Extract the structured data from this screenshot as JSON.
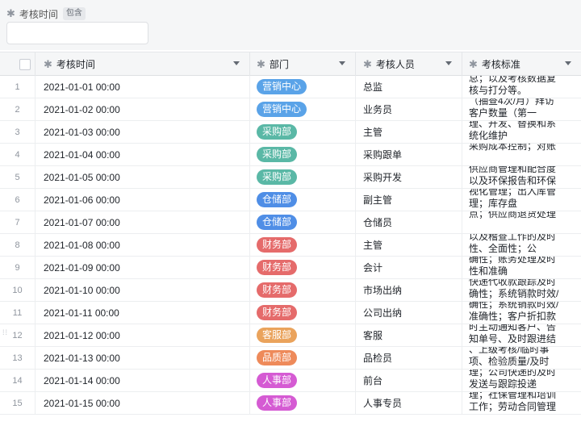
{
  "filter": {
    "field_label": "考核时间",
    "operator": "包含",
    "value": ""
  },
  "columns": {
    "time": "考核时间",
    "department": "部门",
    "person": "考核人员",
    "standard": "考核标准"
  },
  "colors": {
    "营销中心": "#5aa3e8",
    "采购部": "#5ab8a6",
    "仓储部": "#4f8ee6",
    "财务部": "#e56b6b",
    "客服部": "#eaa35c",
    "品质部": "#ee8a5a",
    "人事部": "#d55bd3"
  },
  "rows": [
    {
      "index": "1",
      "time": "2021-01-01 00:00",
      "department": "营销中心",
      "person": "总监",
      "standard": "总；以及考核数据复核与打分等。"
    },
    {
      "index": "2",
      "time": "2021-01-02 00:00",
      "department": "营销中心",
      "person": "业务员",
      "standard": "（抽查4次/月）拜访客户数量（第一"
    },
    {
      "index": "3",
      "time": "2021-01-03 00:00",
      "department": "采购部",
      "person": "主管",
      "standard": "理、开发、替换和系统化维护"
    },
    {
      "index": "4",
      "time": "2021-01-04 00:00",
      "department": "采购部",
      "person": "采购跟单",
      "standard": "采购成本控制；对账"
    },
    {
      "index": "5",
      "time": "2021-01-05 00:00",
      "department": "采购部",
      "person": "采购开发",
      "standard": "供应商管理和配合度以及环保报告和环保"
    },
    {
      "index": "6",
      "time": "2021-01-06 00:00",
      "department": "仓储部",
      "person": "副主管",
      "standard": "视化管理；出入库管理；库存盘"
    },
    {
      "index": "7",
      "time": "2021-01-07 00:00",
      "department": "仓储部",
      "person": "仓储员",
      "standard": "点；供应商退货处理"
    },
    {
      "index": "8",
      "time": "2021-01-08 00:00",
      "department": "财务部",
      "person": "主管",
      "standard": "以及稽查工作的及时性、全面性；公"
    },
    {
      "index": "9",
      "time": "2021-01-09 00:00",
      "department": "财务部",
      "person": "会计",
      "standard": "确性；账务处理及时性和准确"
    },
    {
      "index": "10",
      "time": "2021-01-10 00:00",
      "department": "财务部",
      "person": "市场出纳",
      "standard": "快递代收款跟踪及时确性；系统销款时效/"
    },
    {
      "index": "11",
      "time": "2021-01-11 00:00",
      "department": "财务部",
      "person": "公司出纳",
      "standard": "确性；系统销款时效/准确性；客户折扣款"
    },
    {
      "index": "12",
      "time": "2021-01-12 00:00",
      "department": "客服部",
      "person": "客服",
      "standard": "时主动通知客户、告知单号、及时跟进结"
    },
    {
      "index": "13",
      "time": "2021-01-13 00:00",
      "department": "品质部",
      "person": "品检员",
      "standard": "、上级考核/临时事项、检验质量/及时"
    },
    {
      "index": "14",
      "time": "2021-01-14 00:00",
      "department": "人事部",
      "person": "前台",
      "standard": "理；公司快递的及时发送与跟踪投递"
    },
    {
      "index": "15",
      "time": "2021-01-15 00:00",
      "department": "人事部",
      "person": "人事专员",
      "standard": "理；社保管理和培训工作；劳动合同管理"
    }
  ]
}
